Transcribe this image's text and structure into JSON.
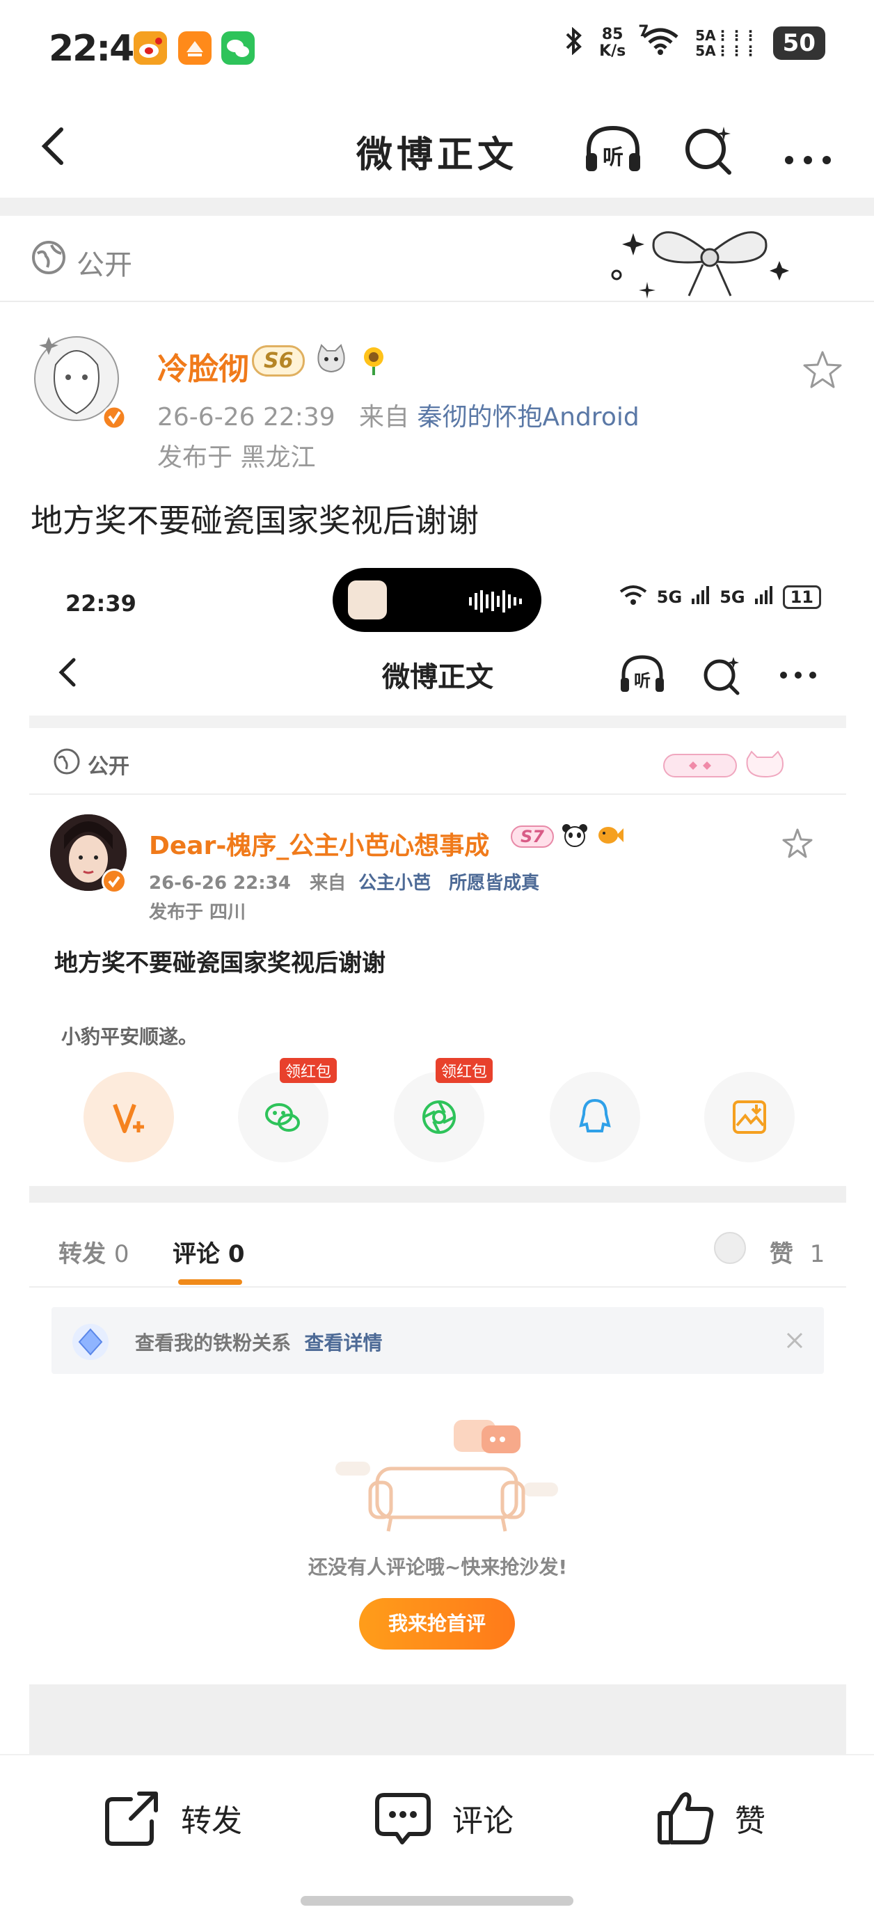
{
  "status_bar": {
    "time": "22:40",
    "net_speed_value": "85",
    "net_speed_unit": "K/s",
    "wifi_label": "7",
    "signal_label_1": "5A",
    "signal_label_2": "5A",
    "battery": "50"
  },
  "nav": {
    "title": "微博正文",
    "listen_icon": "listen-icon",
    "search_icon": "search-icon",
    "more_icon": "more-icon"
  },
  "post": {
    "visibility": "公开",
    "author": "冷脸彻",
    "level_badge": "S6",
    "time": "26-6-26 22:39",
    "source_prefix": "来自",
    "source": "秦彻的怀抱Android",
    "location": "发布于 黑龙江",
    "text": "地方奖不要碰瓷国家奖视后谢谢"
  },
  "embedded": {
    "status": {
      "time": "22:39",
      "battery": "11",
      "net_label_1": "5G",
      "net_label_2": "5G"
    },
    "nav": {
      "title": "微博正文"
    },
    "visibility": "公开",
    "author": "Dear-槐序_公主小芭心想事成",
    "level_badge": "S7",
    "time": "26-6-26 22:34",
    "source_prefix": "来自",
    "source": "公主小芭　所愿皆成真",
    "location": "发布于 四川",
    "text": "地方奖不要碰瓷国家奖视后谢谢",
    "subtext": "小豹平安顺遂。",
    "share_tags": [
      "领红包",
      "领红包"
    ],
    "tabs": {
      "repost": "转发",
      "repost_count": "0",
      "comment": "评论",
      "comment_count": "0",
      "like": "赞",
      "like_count": "1"
    },
    "notice": {
      "text": "查看我的铁粉关系",
      "link": "查看详情"
    },
    "empty": {
      "text": "还没有人评论哦~快来抢沙发!",
      "button": "我来抢首评"
    }
  },
  "bottom_bar": {
    "repost": "转发",
    "comment": "评论",
    "like": "赞"
  },
  "colors": {
    "accent": "#f07a1a",
    "link": "#5a78a6"
  }
}
